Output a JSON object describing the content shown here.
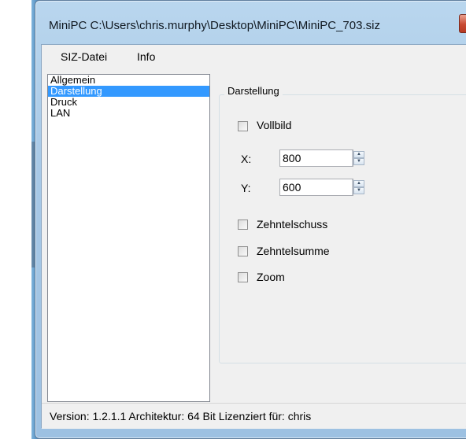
{
  "window": {
    "title": "MiniPC C:\\Users\\chris.murphy\\Desktop\\MiniPC\\MiniPC_703.siz"
  },
  "menu": {
    "items": [
      {
        "label": "SIZ-Datei"
      },
      {
        "label": "Info"
      }
    ]
  },
  "categories": {
    "items": [
      {
        "label": "Allgemein",
        "selected": false
      },
      {
        "label": "Darstellung",
        "selected": true
      },
      {
        "label": "Druck",
        "selected": false
      },
      {
        "label": "LAN",
        "selected": false
      }
    ]
  },
  "group": {
    "title": "Darstellung",
    "vollbild": {
      "label": "Vollbild",
      "checked": false
    },
    "x": {
      "label": "X:",
      "value": "800"
    },
    "y": {
      "label": "Y:",
      "value": "600"
    },
    "zehntelschuss": {
      "label": "Zehntelschuss",
      "checked": false
    },
    "zehntelsumme": {
      "label": "Zehntelsumme",
      "checked": false
    },
    "zoom": {
      "label": "Zoom",
      "checked": false
    }
  },
  "status": {
    "text": "Version: 1.2.1.1 Architektur: 64 Bit Lizenziert für: chris"
  },
  "colors": {
    "selection": "#3399ff",
    "frame": "#a7c8e6",
    "client": "#f0f0f0"
  }
}
